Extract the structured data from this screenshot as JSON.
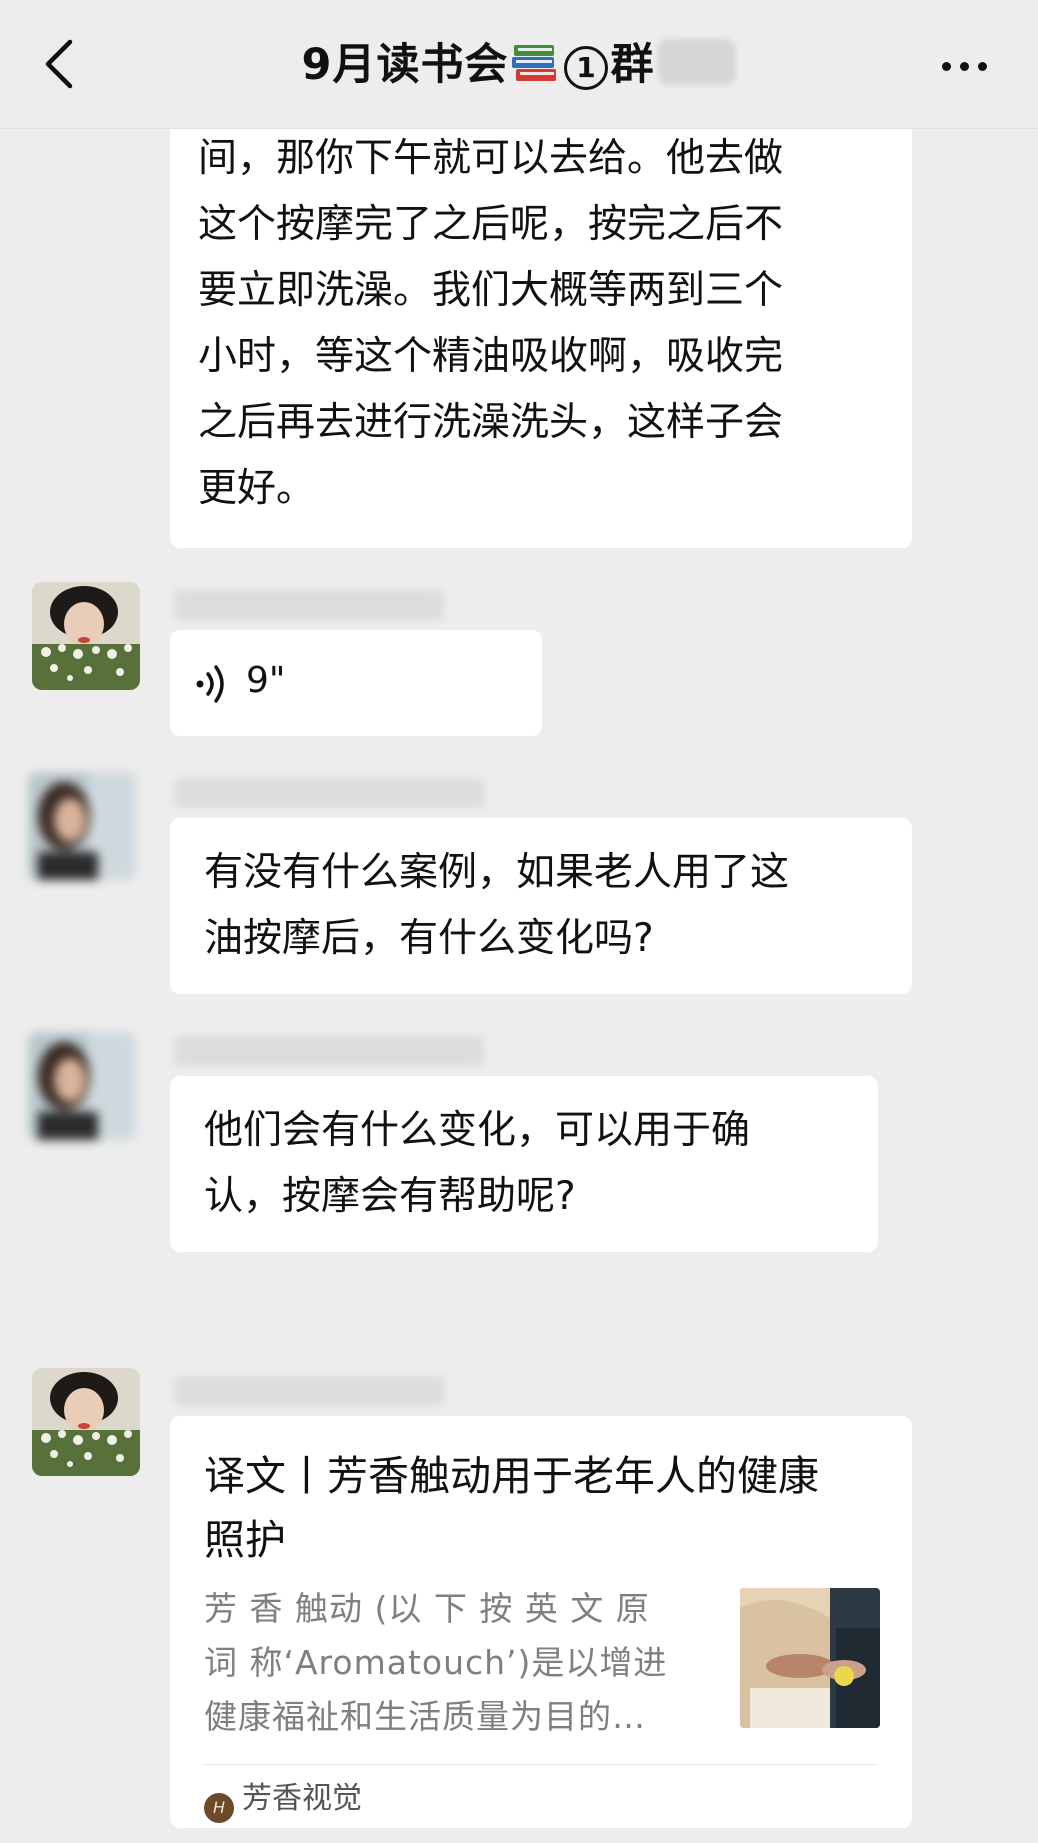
{
  "header": {
    "title_prefix": "9月读书会",
    "book_icon": "books-emoji",
    "circled_number": "1",
    "title_suffix": "群",
    "back_icon": "chevron-left-icon",
    "more_icon": "more-icon"
  },
  "messages": [
    {
      "lines": [
        "间，那你下午就可以去给。他去做",
        "这个按摩完了之后呢，按完之后不",
        "要立即洗澡。我们大概等两到三个",
        "小时，等这个精油吸收啊，吸收完",
        "之后再去进行洗澡洗头，这样子会",
        "更好。"
      ]
    },
    {
      "voice_duration": "9\""
    },
    {
      "lines": [
        "有没有什么案例，如果老人用了这",
        "油按摩后，有什么变化吗?"
      ]
    },
    {
      "lines": [
        "他们会有什么变化，可以用于确",
        "认，按摩会有帮助呢?"
      ]
    },
    {
      "card_title_lines": [
        "译文丨芳香触动用于老年人的健康",
        "照护"
      ],
      "card_desc_lines": [
        "芳 香 触动 (以 下 按 英 文 原",
        "词 称‘Aromatouch’)是以增进",
        "健康福祉和生活质量为目的…"
      ],
      "card_source": "芳香视觉"
    }
  ]
}
